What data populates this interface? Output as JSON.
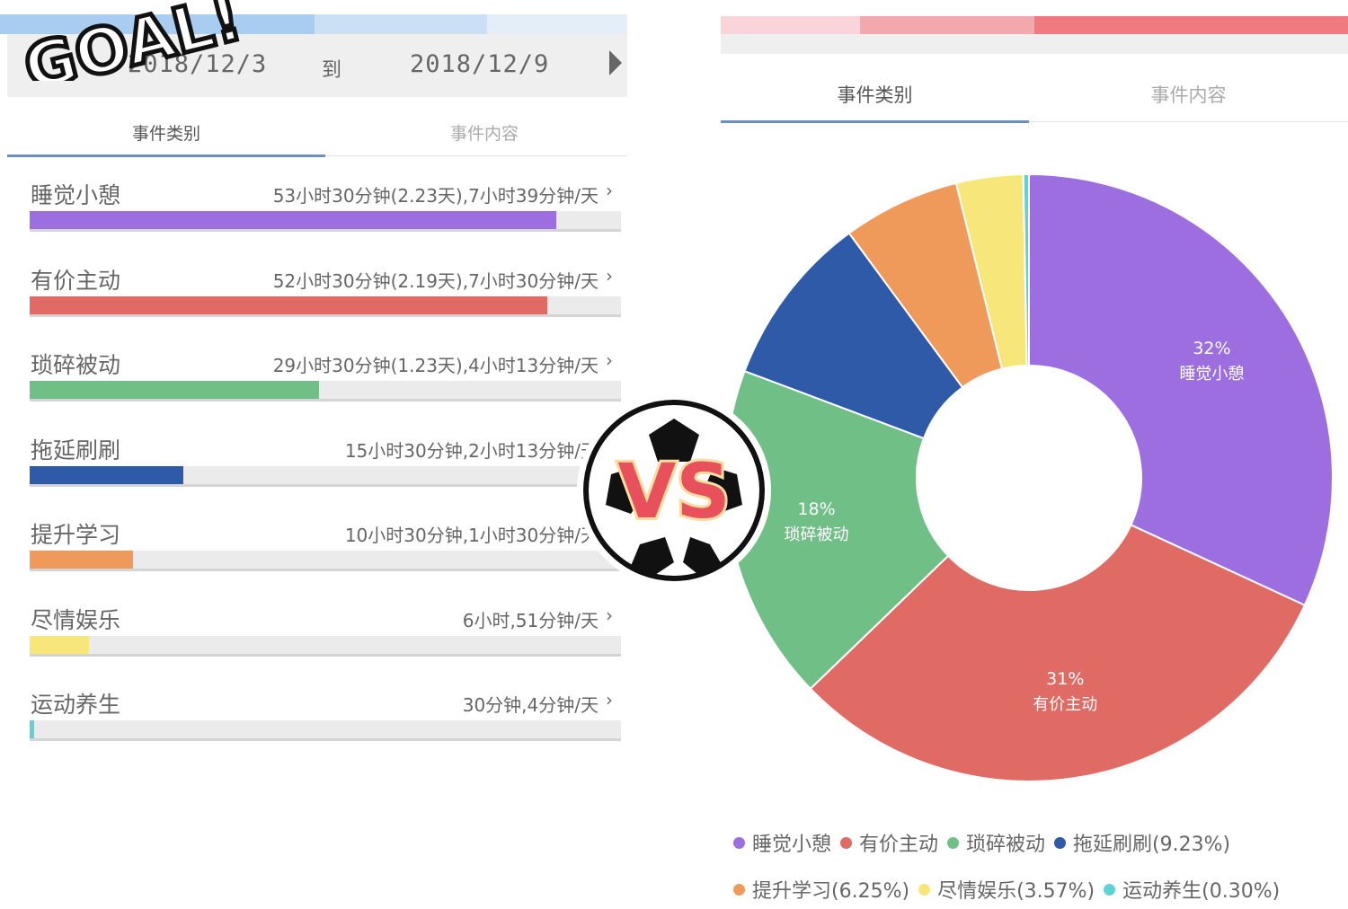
{
  "left": {
    "date_start": "2018/12/3",
    "date_to": "到",
    "date_end": "2018/12/9",
    "tabs": [
      "事件类别",
      "事件内容"
    ],
    "rows": [
      {
        "name": "睡觉小憩",
        "detail": "53小时30分钟(2.23天),7小时39分钟/天",
        "fraction": 0.89,
        "color": "#9d6ee0"
      },
      {
        "name": "有价主动",
        "detail": "52小时30分钟(2.19天),7小时30分钟/天",
        "fraction": 0.875,
        "color": "#e06a64"
      },
      {
        "name": "琐碎被动",
        "detail": "29小时30分钟(1.23天),4小时13分钟/天",
        "fraction": 0.49,
        "color": "#6fbf86"
      },
      {
        "name": "拖延刷刷",
        "detail": "15小时30分钟,2小时13分钟/天",
        "fraction": 0.26,
        "color": "#2f5aa8"
      },
      {
        "name": "提升学习",
        "detail": "10小时30分钟,1小时30分钟/天",
        "fraction": 0.175,
        "color": "#ef9a5a"
      },
      {
        "name": "尽情娱乐",
        "detail": "6小时,51分钟/天",
        "fraction": 0.1,
        "color": "#f7e67a"
      },
      {
        "name": "运动养生",
        "detail": "30分钟,4分钟/天",
        "fraction": 0.008,
        "color": "#5fd3cf"
      }
    ]
  },
  "right": {
    "tabs": [
      "事件类别",
      "事件内容"
    ]
  },
  "overlay": {
    "goal_text": "GOAL!",
    "vs_text": "VS"
  },
  "chart_data": {
    "type": "pie",
    "donut": true,
    "slices": [
      {
        "name": "睡觉小憩",
        "value": 32.0,
        "label": "32%",
        "color": "#9d6ee0"
      },
      {
        "name": "有价主动",
        "value": 31.0,
        "label": "31%",
        "color": "#e06a64"
      },
      {
        "name": "琐碎被动",
        "value": 18.0,
        "label": "18%",
        "color": "#6fbf86"
      },
      {
        "name": "拖延刷刷",
        "value": 9.23,
        "label": "",
        "color": "#2f5aa8"
      },
      {
        "name": "提升学习",
        "value": 6.25,
        "label": "",
        "color": "#ef9a5a"
      },
      {
        "name": "尽情娱乐",
        "value": 3.57,
        "label": "",
        "color": "#f7e67a"
      },
      {
        "name": "运动养生",
        "value": 0.3,
        "label": "",
        "color": "#5fd3cf"
      }
    ],
    "legend": {
      "position": "bottom",
      "rows": [
        [
          {
            "text": "睡觉小憩",
            "color": "#9d6ee0"
          },
          {
            "text": "有价主动",
            "color": "#e06a64"
          },
          {
            "text": "琐碎被动",
            "color": "#6fbf86"
          },
          {
            "text": "拖延刷刷(9.23%)",
            "color": "#2f5aa8"
          }
        ],
        [
          {
            "text": "提升学习(6.25%)",
            "color": "#ef9a5a"
          },
          {
            "text": "尽情娱乐(3.57%)",
            "color": "#f7e67a"
          },
          {
            "text": "运动养生(0.30%)",
            "color": "#5fd3cf"
          }
        ]
      ]
    }
  }
}
